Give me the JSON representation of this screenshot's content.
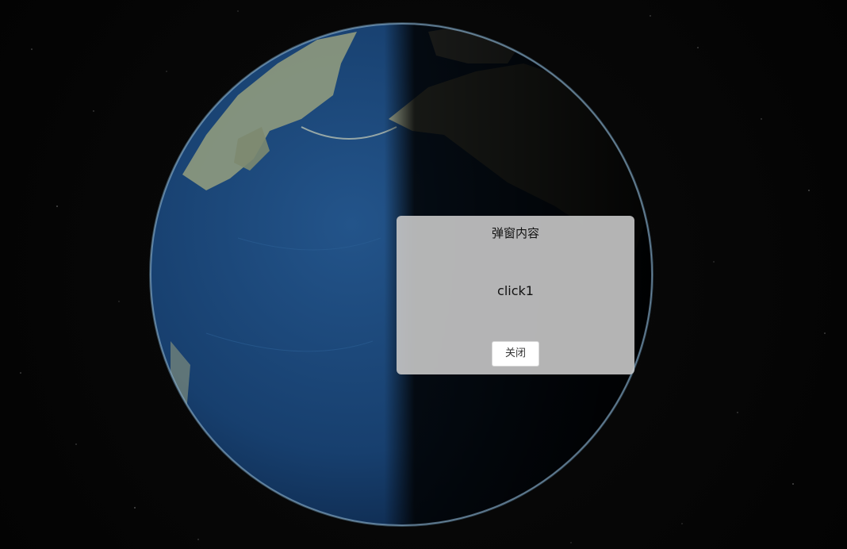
{
  "popup": {
    "title": "弹窗内容",
    "content": "click1",
    "close_label": "关闭"
  },
  "colors": {
    "space": "#050505",
    "ocean": "#1d4a78",
    "ocean_deep": "#0f2f57",
    "land": "#8e9a7c",
    "night": "#000000",
    "popup_bg": "#c8c8c8"
  }
}
